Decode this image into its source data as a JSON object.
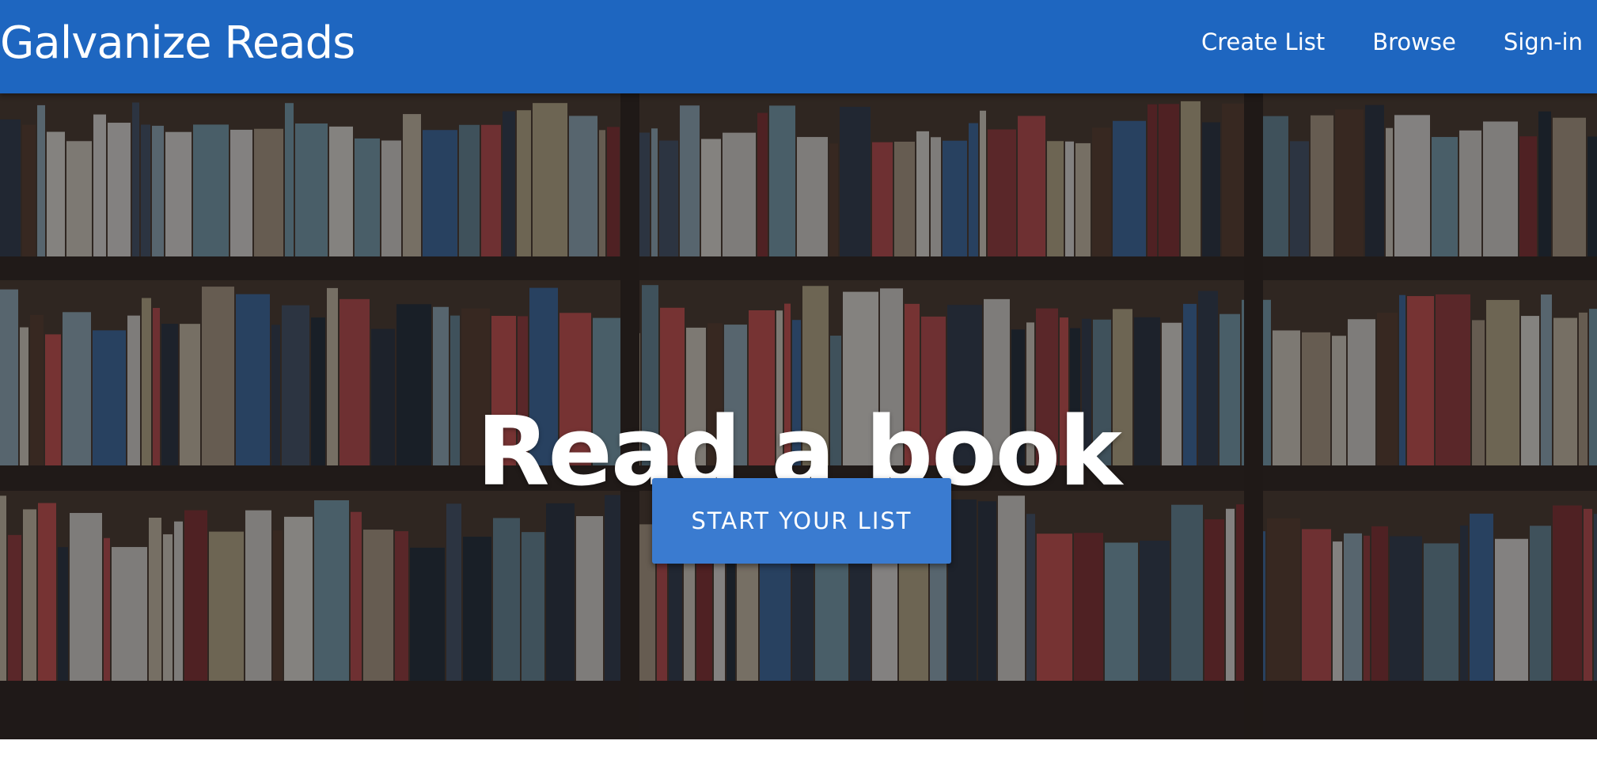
{
  "navbar": {
    "brand": "Galvanize Reads",
    "links": [
      "Create List",
      "Browse",
      "Sign-in"
    ]
  },
  "hero": {
    "title": "Read a book",
    "button_label": "START YOUR LIST",
    "background_image": "bookshelf-photo"
  },
  "colors": {
    "navbar": "#1e66c0",
    "button": "#3a7bd0",
    "text": "#ffffff"
  }
}
